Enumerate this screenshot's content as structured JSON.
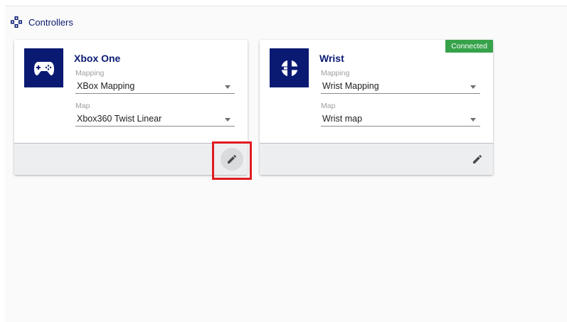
{
  "section": {
    "title": "Controllers",
    "icon": "gamepad-nodes-icon"
  },
  "controllers": [
    {
      "name": "Xbox One",
      "icon": "gamepad-icon",
      "mapping_label": "Mapping",
      "mapping_value": "XBox Mapping",
      "map_label": "Map",
      "map_value": "Xbox360 Twist Linear",
      "status": "",
      "edit_icon": "pencil-icon"
    },
    {
      "name": "Wrist",
      "icon": "wrist-disc-icon",
      "mapping_label": "Mapping",
      "mapping_value": "Wrist Mapping",
      "map_label": "Map",
      "map_value": "Wrist map",
      "status": "Connected",
      "edit_icon": "pencil-icon"
    }
  ],
  "colors": {
    "brand": "#0a1a73",
    "connected": "#36a24a",
    "highlight": "#e11b22",
    "footer": "#eceef0"
  }
}
